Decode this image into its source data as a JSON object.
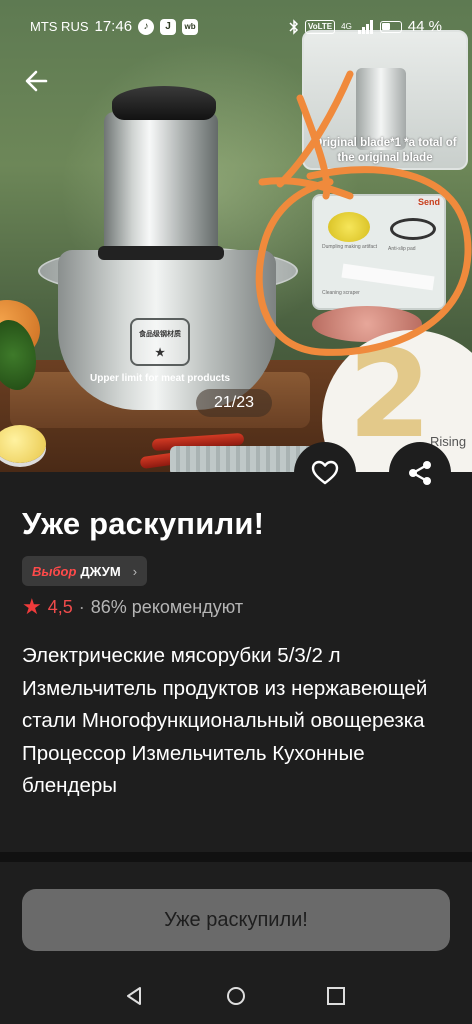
{
  "status_bar": {
    "carrier": "MTS RUS",
    "time": "17:46",
    "app_icons": [
      "♪",
      "J",
      "wb"
    ],
    "network_badge": "VoLTE",
    "lte": "4G",
    "battery": "44 %"
  },
  "gallery": {
    "pager": "21/23",
    "overlay_caption": "Upper limit for meat products",
    "emblem_text": "食品级钢材质",
    "inset_caption": "Original blade*1 *a total of the original blade",
    "accessory_send": "Send",
    "accessory_label_1": "Dumpling making artifact",
    "accessory_label_2": "Anti-slip pad",
    "accessory_label_3": "Cleaning scraper",
    "big_number": "2",
    "big_number_caption": "Rising"
  },
  "product": {
    "title": "Уже раскупили!",
    "choice_label": "Выбор",
    "choice_brand": "ДЖУМ",
    "rating": "4,5",
    "recommend": "86% рекомендуют",
    "description": "Электрические мясорубки 5/3/2 л Измельчитель продуктов из нержавеющей стали Многофункциональный овощерезка Процессор Измельчитель Кухонные блендеры"
  },
  "bottom_bar": {
    "cta_label": "Уже раскупили!"
  },
  "colors": {
    "background": "#1e1e1e",
    "rating_star": "#ef3b3b",
    "choice_accent": "#ff4a4a",
    "annotation_orange": "#f08a3c",
    "cta_disabled": "#6a6a6a"
  },
  "icons": {
    "back": "arrow-left-icon",
    "favorite": "heart-icon",
    "share": "share-icon",
    "chip_chevron": "chevron-right-icon",
    "nav_back": "triangle-back-icon",
    "nav_home": "circle-home-icon",
    "nav_recent": "square-recents-icon"
  }
}
